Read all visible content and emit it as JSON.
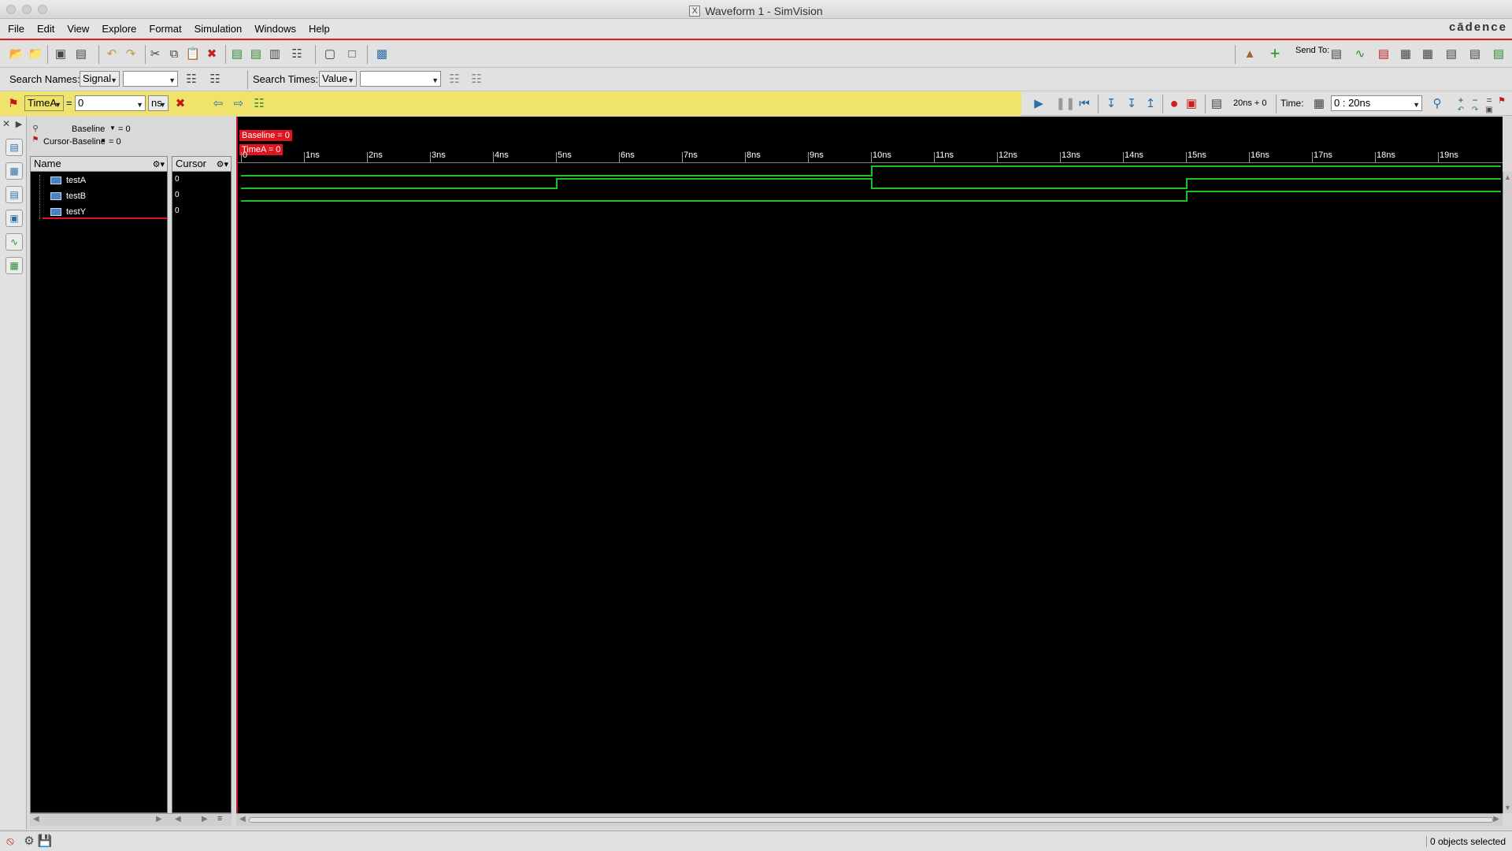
{
  "window": {
    "title": "Waveform 1 - SimVision"
  },
  "menu": [
    "File",
    "Edit",
    "View",
    "Explore",
    "Format",
    "Simulation",
    "Windows",
    "Help"
  ],
  "brand": "cādence",
  "toolbar": {
    "send_to_label": "Send To:"
  },
  "search": {
    "names_label": "Search Names:",
    "names_type": "Signal",
    "names_value": "",
    "times_label": "Search Times:",
    "times_type": "Value",
    "times_value": ""
  },
  "cursor_bar": {
    "cursor_name": "TimeA",
    "equals": "=",
    "cursor_value": "0",
    "unit": "ns",
    "interval_readout": "20ns + 0",
    "time_label": "Time:",
    "time_range": "0 : 20ns"
  },
  "baseline": {
    "baseline_label": "Baseline",
    "baseline_value": "= 0",
    "cursor_baseline_label": "Cursor-Baseline",
    "cursor_baseline_value": "= 0"
  },
  "columns": {
    "name": "Name",
    "cursor": "Cursor"
  },
  "signals": [
    {
      "name": "testA",
      "cursor_value": "0"
    },
    {
      "name": "testB",
      "cursor_value": "0"
    },
    {
      "name": "testY",
      "cursor_value": "0"
    }
  ],
  "markers": {
    "baseline": "Baseline = 0",
    "timeA": "TimeA = 0"
  },
  "timeline_ticks": [
    "0",
    "1ns",
    "2ns",
    "3ns",
    "4ns",
    "5ns",
    "6ns",
    "7ns",
    "8ns",
    "9ns",
    "10ns",
    "11ns",
    "12ns",
    "13ns",
    "14ns",
    "15ns",
    "16ns",
    "17ns",
    "18ns",
    "19ns"
  ],
  "waveform_data": {
    "time_range_ns": [
      0,
      20
    ],
    "traces": [
      {
        "name": "testA",
        "transitions": [
          {
            "t": 0,
            "v": 0
          },
          {
            "t": 10,
            "v": 1
          }
        ]
      },
      {
        "name": "testB",
        "transitions": [
          {
            "t": 0,
            "v": 0
          },
          {
            "t": 5,
            "v": 1
          },
          {
            "t": 10,
            "v": 0
          },
          {
            "t": 15,
            "v": 1
          }
        ]
      },
      {
        "name": "testY",
        "transitions": [
          {
            "t": 0,
            "v": 0
          },
          {
            "t": 15,
            "v": 1
          }
        ]
      }
    ]
  },
  "status": {
    "text": "0 objects selected"
  },
  "colors": {
    "accent": "#d9201f",
    "signal": "#1fc11f",
    "cursor_bar": "#efe36b"
  }
}
